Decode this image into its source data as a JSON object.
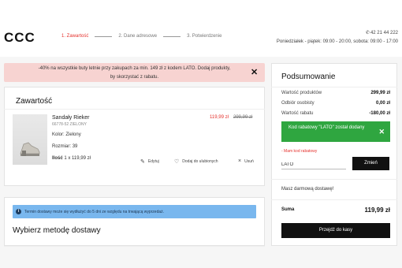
{
  "header": {
    "logo": "CCC",
    "steps": [
      "1. Zawartość",
      "2. Dane adresowe",
      "3. Potwierdzenie"
    ],
    "phone": "42 21 44 222",
    "hours": "Poniedziałek - piątek: 09:00 - 20:00, sobota: 09:00 - 17:00"
  },
  "promo": {
    "line1": "-40% na wszystkie buty letnie przy zakupach za min. 149 zł z kodem LATO. Dodaj produkty,",
    "line2": "by skorzystać z rabatu."
  },
  "cart": {
    "title": "Zawartość",
    "product": {
      "name": "Sandały Rieker",
      "code": "66778-52 ZIELONY",
      "color_label": "Kolor:",
      "color_value": "Zielony",
      "size_label": "Rozmiar:",
      "size_value": "39",
      "qty_label": "Ilość",
      "qty_value": "1 x 119,99 zł",
      "price_new": "119,99 zł",
      "price_old": "299,99 zł"
    },
    "actions": {
      "edit": "Edytuj",
      "favorite": "Dodaj do ulubionych",
      "remove": "Usuń"
    }
  },
  "delivery": {
    "notice": "Termin dostawy może się wydłużyć do 5 dni ze względu na trwającą wyprzedaż.",
    "title": "Wybierz metodę dostawy"
  },
  "summary": {
    "title": "Podsumowanie",
    "rows": [
      {
        "label": "Wartość produktów",
        "value": "299,99 zł"
      },
      {
        "label": "Odbiór osobisty",
        "value": "0,00 zł"
      },
      {
        "label": "Wartość rabatu",
        "value": "-180,00 zł"
      }
    ],
    "coupon_success": "Kod rabatowy \"LATO\" został dodany",
    "coupon_label": "- Mam kod rabatowy",
    "coupon_value": "LATO",
    "coupon_button": "Zmień",
    "free_shipping": "Masz darmową dostawę!",
    "total_label": "Suma",
    "total_value": "119,99 zł",
    "checkout": "Przejdź do kasy"
  },
  "colors": {
    "accent_red": "#e5322d",
    "success_green": "#2fa640",
    "promo_pink": "#f7d3d1",
    "notice_blue": "#79b7ee"
  }
}
